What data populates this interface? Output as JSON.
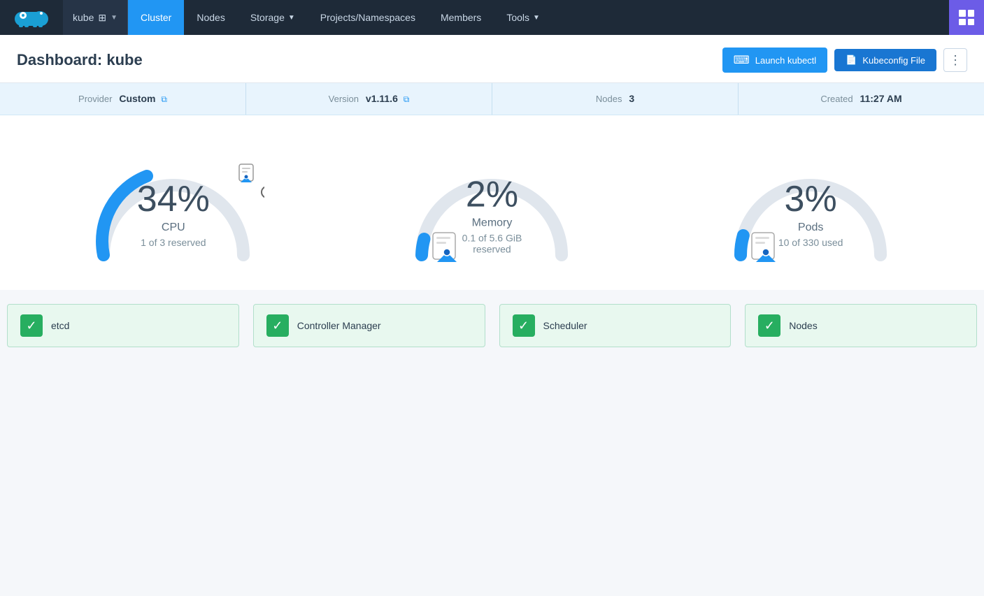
{
  "nav": {
    "cluster_name": "kube",
    "items": [
      {
        "id": "cluster",
        "label": "Cluster",
        "active": true
      },
      {
        "id": "nodes",
        "label": "Nodes",
        "active": false
      },
      {
        "id": "storage",
        "label": "Storage",
        "active": false,
        "dropdown": true
      },
      {
        "id": "projects",
        "label": "Projects/Namespaces",
        "active": false
      },
      {
        "id": "members",
        "label": "Members",
        "active": false
      },
      {
        "id": "tools",
        "label": "Tools",
        "active": false,
        "dropdown": true
      }
    ]
  },
  "header": {
    "title_prefix": "Dashboard: ",
    "title_name": "kube",
    "btn_kubectl": "Launch kubectl",
    "btn_kubeconfig": "Kubeconfig File",
    "btn_more": "⋮"
  },
  "info_bar": {
    "provider_label": "Provider",
    "provider_value": "Custom",
    "version_label": "Version",
    "version_value": "v1.11.6",
    "nodes_label": "Nodes",
    "nodes_value": "3",
    "created_label": "Created",
    "created_value": "11:27 AM"
  },
  "gauges": [
    {
      "id": "cpu",
      "pct": "34%",
      "name": "CPU",
      "sub": "1 of 3 reserved",
      "value": 34,
      "color": "#2196f3",
      "indicator_pos": "left"
    },
    {
      "id": "memory",
      "pct": "2%",
      "name": "Memory",
      "sub": "0.1 of 5.6 GiB reserved",
      "value": 2,
      "color": "#2196f3",
      "indicator_pos": "bottom-left"
    },
    {
      "id": "pods",
      "pct": "3%",
      "name": "Pods",
      "sub": "10 of 330 used",
      "value": 3,
      "color": "#2196f3",
      "indicator_pos": "bottom-left"
    }
  ],
  "status_cards": [
    {
      "id": "etcd",
      "label": "etcd",
      "ok": true
    },
    {
      "id": "controller-manager",
      "label": "Controller Manager",
      "ok": true
    },
    {
      "id": "scheduler",
      "label": "Scheduler",
      "ok": true
    },
    {
      "id": "nodes",
      "label": "Nodes",
      "ok": true
    }
  ]
}
